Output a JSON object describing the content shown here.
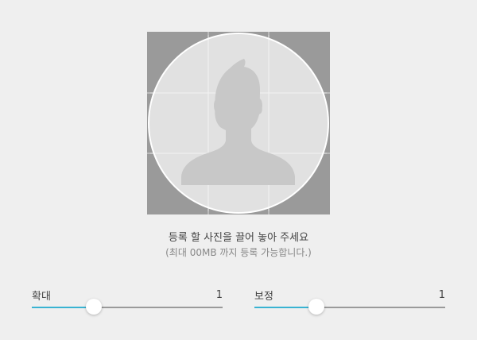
{
  "upload": {
    "placeholder_icon": "person-silhouette-icon",
    "instruction": "등록 할 사진을 끌어 놓아 주세요",
    "limit_note": "(최대 00MB 까지 등록 가능합니다.)"
  },
  "sliders": {
    "zoom": {
      "label": "확대",
      "value": "1",
      "level": 0.325
    },
    "adjust": {
      "label": "보정",
      "value": "1",
      "level": 0.325
    }
  },
  "colors": {
    "background": "#efefef",
    "photo_backdrop": "#9a9a9a",
    "circle_fill": "#e1e1e1",
    "silhouette": "#c8c8c8",
    "accent": "#39b3d2",
    "track": "#9a9a9a"
  }
}
